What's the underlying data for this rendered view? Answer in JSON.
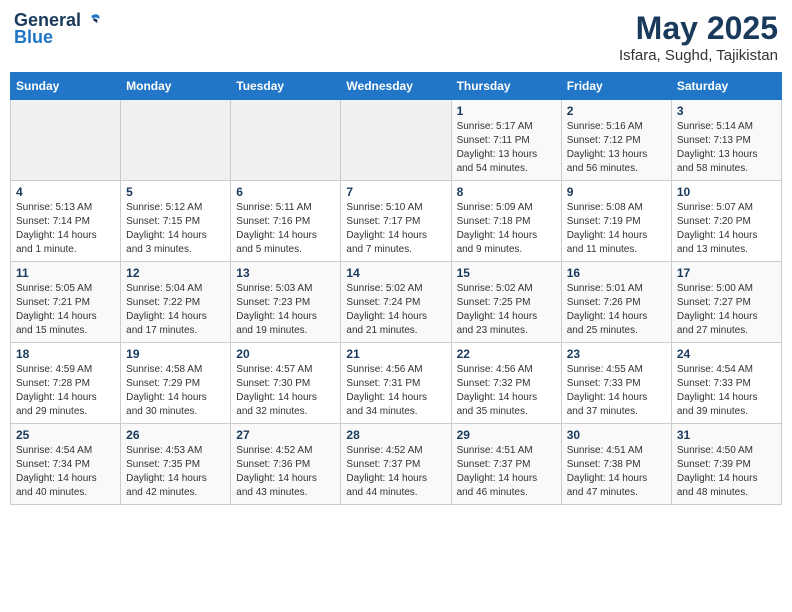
{
  "header": {
    "logo_general": "General",
    "logo_blue": "Blue",
    "month_year": "May 2025",
    "location": "Isfara, Sughd, Tajikistan"
  },
  "weekdays": [
    "Sunday",
    "Monday",
    "Tuesday",
    "Wednesday",
    "Thursday",
    "Friday",
    "Saturday"
  ],
  "rows": [
    [
      {
        "day": "",
        "info": ""
      },
      {
        "day": "",
        "info": ""
      },
      {
        "day": "",
        "info": ""
      },
      {
        "day": "",
        "info": ""
      },
      {
        "day": "1",
        "info": "Sunrise: 5:17 AM\nSunset: 7:11 PM\nDaylight: 13 hours\nand 54 minutes."
      },
      {
        "day": "2",
        "info": "Sunrise: 5:16 AM\nSunset: 7:12 PM\nDaylight: 13 hours\nand 56 minutes."
      },
      {
        "day": "3",
        "info": "Sunrise: 5:14 AM\nSunset: 7:13 PM\nDaylight: 13 hours\nand 58 minutes."
      }
    ],
    [
      {
        "day": "4",
        "info": "Sunrise: 5:13 AM\nSunset: 7:14 PM\nDaylight: 14 hours\nand 1 minute."
      },
      {
        "day": "5",
        "info": "Sunrise: 5:12 AM\nSunset: 7:15 PM\nDaylight: 14 hours\nand 3 minutes."
      },
      {
        "day": "6",
        "info": "Sunrise: 5:11 AM\nSunset: 7:16 PM\nDaylight: 14 hours\nand 5 minutes."
      },
      {
        "day": "7",
        "info": "Sunrise: 5:10 AM\nSunset: 7:17 PM\nDaylight: 14 hours\nand 7 minutes."
      },
      {
        "day": "8",
        "info": "Sunrise: 5:09 AM\nSunset: 7:18 PM\nDaylight: 14 hours\nand 9 minutes."
      },
      {
        "day": "9",
        "info": "Sunrise: 5:08 AM\nSunset: 7:19 PM\nDaylight: 14 hours\nand 11 minutes."
      },
      {
        "day": "10",
        "info": "Sunrise: 5:07 AM\nSunset: 7:20 PM\nDaylight: 14 hours\nand 13 minutes."
      }
    ],
    [
      {
        "day": "11",
        "info": "Sunrise: 5:05 AM\nSunset: 7:21 PM\nDaylight: 14 hours\nand 15 minutes."
      },
      {
        "day": "12",
        "info": "Sunrise: 5:04 AM\nSunset: 7:22 PM\nDaylight: 14 hours\nand 17 minutes."
      },
      {
        "day": "13",
        "info": "Sunrise: 5:03 AM\nSunset: 7:23 PM\nDaylight: 14 hours\nand 19 minutes."
      },
      {
        "day": "14",
        "info": "Sunrise: 5:02 AM\nSunset: 7:24 PM\nDaylight: 14 hours\nand 21 minutes."
      },
      {
        "day": "15",
        "info": "Sunrise: 5:02 AM\nSunset: 7:25 PM\nDaylight: 14 hours\nand 23 minutes."
      },
      {
        "day": "16",
        "info": "Sunrise: 5:01 AM\nSunset: 7:26 PM\nDaylight: 14 hours\nand 25 minutes."
      },
      {
        "day": "17",
        "info": "Sunrise: 5:00 AM\nSunset: 7:27 PM\nDaylight: 14 hours\nand 27 minutes."
      }
    ],
    [
      {
        "day": "18",
        "info": "Sunrise: 4:59 AM\nSunset: 7:28 PM\nDaylight: 14 hours\nand 29 minutes."
      },
      {
        "day": "19",
        "info": "Sunrise: 4:58 AM\nSunset: 7:29 PM\nDaylight: 14 hours\nand 30 minutes."
      },
      {
        "day": "20",
        "info": "Sunrise: 4:57 AM\nSunset: 7:30 PM\nDaylight: 14 hours\nand 32 minutes."
      },
      {
        "day": "21",
        "info": "Sunrise: 4:56 AM\nSunset: 7:31 PM\nDaylight: 14 hours\nand 34 minutes."
      },
      {
        "day": "22",
        "info": "Sunrise: 4:56 AM\nSunset: 7:32 PM\nDaylight: 14 hours\nand 35 minutes."
      },
      {
        "day": "23",
        "info": "Sunrise: 4:55 AM\nSunset: 7:33 PM\nDaylight: 14 hours\nand 37 minutes."
      },
      {
        "day": "24",
        "info": "Sunrise: 4:54 AM\nSunset: 7:33 PM\nDaylight: 14 hours\nand 39 minutes."
      }
    ],
    [
      {
        "day": "25",
        "info": "Sunrise: 4:54 AM\nSunset: 7:34 PM\nDaylight: 14 hours\nand 40 minutes."
      },
      {
        "day": "26",
        "info": "Sunrise: 4:53 AM\nSunset: 7:35 PM\nDaylight: 14 hours\nand 42 minutes."
      },
      {
        "day": "27",
        "info": "Sunrise: 4:52 AM\nSunset: 7:36 PM\nDaylight: 14 hours\nand 43 minutes."
      },
      {
        "day": "28",
        "info": "Sunrise: 4:52 AM\nSunset: 7:37 PM\nDaylight: 14 hours\nand 44 minutes."
      },
      {
        "day": "29",
        "info": "Sunrise: 4:51 AM\nSunset: 7:37 PM\nDaylight: 14 hours\nand 46 minutes."
      },
      {
        "day": "30",
        "info": "Sunrise: 4:51 AM\nSunset: 7:38 PM\nDaylight: 14 hours\nand 47 minutes."
      },
      {
        "day": "31",
        "info": "Sunrise: 4:50 AM\nSunset: 7:39 PM\nDaylight: 14 hours\nand 48 minutes."
      }
    ]
  ]
}
